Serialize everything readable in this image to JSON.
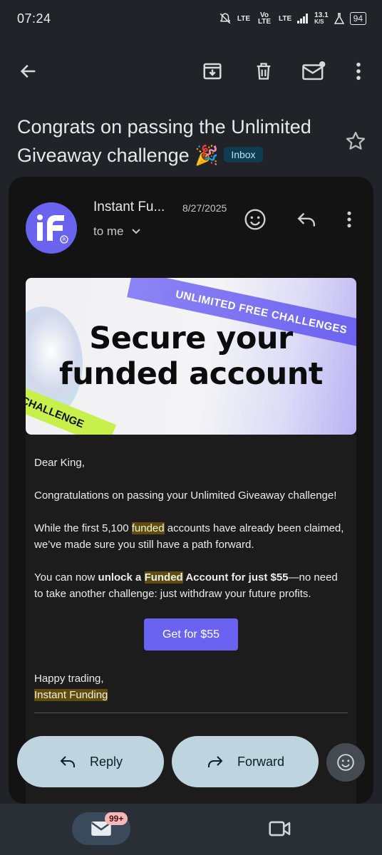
{
  "status_bar": {
    "time": "07:24",
    "net1": "LTE",
    "volte": "Vo LTE",
    "net2": "LTE",
    "speed": "13.1",
    "speed_unit": "K/S",
    "battery": "94"
  },
  "toolbar": {
    "back_icon": "arrow-left",
    "archive_icon": "archive-down",
    "delete_icon": "trash",
    "unread_icon": "mail-unread",
    "more_icon": "more-vertical"
  },
  "email": {
    "subject": "Congrats on passing the Unlimited Giveaway challenge",
    "subject_emoji": "🎉",
    "label": "Inbox",
    "sender": "Instant Fu...",
    "date": "8/27/2025",
    "recipient": "to me",
    "avatar_brand": "iF",
    "banner": {
      "headline_line1": "Secure your",
      "headline_line2": "funded account",
      "ribbon_top": "UNLIMITED FREE CHALLENGES",
      "ribbon_left": "CHALLENGE"
    },
    "greeting": "Dear King,",
    "p1": "Congratulations on passing your Unlimited Giveaway challenge!",
    "p2_a": "While the first 5,100 ",
    "p2_hl": "funded",
    "p2_b": " accounts have already been claimed, we’ve made sure you still have a path forward.",
    "p3_a": "You can now ",
    "p3_b1": "unlock a ",
    "p3_hl": "Funded",
    "p3_b2": " Account for just $55",
    "p3_c": "—no need to take another challenge: just withdraw your future profits.",
    "cta": "Get for $55",
    "signoff": "Happy trading,",
    "signature": "Instant Funding"
  },
  "actions": {
    "reply": "Reply",
    "forward": "Forward"
  },
  "nav": {
    "mail_badge": "99+"
  },
  "colors": {
    "accent": "#6a63f2",
    "highlight": "#5e4d0e",
    "pill": "#bed4de"
  }
}
